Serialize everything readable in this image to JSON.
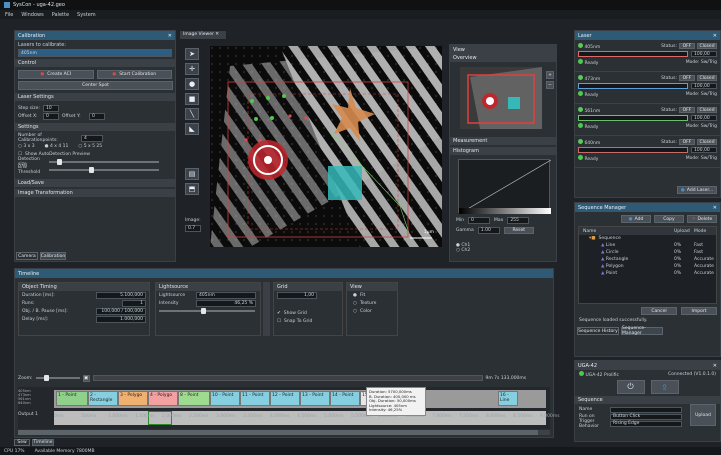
{
  "titlebar": {
    "title": "SysCon - uga-42.geo"
  },
  "menu": [
    "File",
    "Windows",
    "Palette",
    "System"
  ],
  "calibration": {
    "header": "Calibration",
    "lasers_label": "Lasers to calibrate:",
    "laser_value": "405nm",
    "control_label": "Control",
    "create_btn": "Create ACI",
    "start_btn": "Start Calibration",
    "center_btn": "Center Spot",
    "laser_settings": "Laser Settings",
    "step_size_label": "Step size:",
    "step_size": "10",
    "offset_x_label": "Offset X:",
    "offset_x": "0",
    "offset_y_label": "Offset Y:",
    "offset_y": "0",
    "settings": "Settings",
    "num_points_label": "Number of Calibrationpoints:",
    "num_points": "4",
    "radio_3x3": "3 x 3",
    "radio_4x4": "4 x 4 11",
    "radio_5x5": "5 x 5 25",
    "show_auto": "Show AutoDetection Preview",
    "detection_size": "Detection size",
    "bw_threshold": "B/W Threshold",
    "load_save": "Load/Save",
    "image_transformation": "Image Transformation",
    "tabs": [
      "Camera",
      "Calibration"
    ]
  },
  "viewer": {
    "tab": "Image Viewer",
    "scale_label": "1µm",
    "tools": [
      "select-icon",
      "move-icon",
      "circle-icon",
      "rect-icon",
      "line-icon",
      "polygon-icon"
    ],
    "zoom_label": "Image:",
    "zoom_value": "0.7"
  },
  "view_panel": {
    "header": "View",
    "overview": "Overview",
    "measurement": "Measurement",
    "histogram": "Histogram",
    "min_label": "Min",
    "min": "0",
    "max_label": "Max",
    "max": "255",
    "gamma_label": "Gamma",
    "gamma": "1.00",
    "reset_btn": "Reset",
    "channel1": "Ch1",
    "channel2": "Ch2"
  },
  "laser_panel": {
    "header": "Laser",
    "lasers": [
      {
        "name": "405nm",
        "status": "OFF",
        "mode": "Closed",
        "value": "100,00",
        "ready": "Ready",
        "modelabel": "Mode: Sw/Trig",
        "color": "#d96a6a"
      },
      {
        "name": "473nm",
        "status": "OFF",
        "mode": "Closed",
        "value": "100,00",
        "ready": "Ready",
        "modelabel": "Mode: Sw/Trig",
        "color": "#5da0d8"
      },
      {
        "name": "561nm",
        "status": "OFF",
        "mode": "Closed",
        "value": "100,00",
        "ready": "Ready",
        "modelabel": "Mode: Sw/Trig",
        "color": "#6bbf6b"
      },
      {
        "name": "640nm",
        "status": "OFF",
        "mode": "Closed",
        "value": "100,00",
        "ready": "Ready",
        "modelabel": "Mode: Sw/Trig",
        "color": "#c96a6a"
      }
    ],
    "add_btn": "Add Laser..."
  },
  "sequence": {
    "header": "Sequence Manager",
    "add_btn": "Add",
    "copy_btn": "Copy",
    "delete_btn": "Delete",
    "columns": [
      "Name",
      "Upload",
      "Mode"
    ],
    "root": "Sequence",
    "items": [
      {
        "name": "Line",
        "upload": "0%",
        "mode": "Fast"
      },
      {
        "name": "Circle",
        "upload": "0%",
        "mode": "Fast"
      },
      {
        "name": "Rectangle",
        "upload": "0%",
        "mode": "Accurate"
      },
      {
        "name": "Polygon",
        "upload": "0%",
        "mode": "Accurate"
      },
      {
        "name": "Point",
        "upload": "0%",
        "mode": "Accurate"
      }
    ],
    "cancel_btn": "Cancel",
    "import_btn": "Import",
    "status": "Sequence loaded successfully.",
    "tabs": [
      "Sequence History",
      "Sequence-Manager"
    ]
  },
  "uga": {
    "header": "UGA-42",
    "device": "UGA-42 Prolific",
    "connected": "Connected (V1.0.1.0)",
    "sequence": "Sequence",
    "name_label": "Name",
    "runs_label": "Run on",
    "runs_value": "Button Click",
    "trigger_label": "Trigger Behavior",
    "trigger_value": "Rising Edge",
    "upload_btn": "Upload"
  },
  "timeline": {
    "header": "Timeline",
    "object_timing": "Object Timing",
    "duration_label": "Duration [ms]:",
    "duration": "5.100,000",
    "runs_label": "Runs:",
    "runs": "1",
    "obj_pause_label": "Obj. / B. Pause [ms]:",
    "obj_pause": "100,000 / 100,000",
    "delay_label": "Delay [ms]:",
    "delay": "1.000,000",
    "lightsource": "Lightsource",
    "ls_label": "Lightsource",
    "ls_value": "405nm",
    "intensity_label": "Intensity",
    "intensity": "46,25 %",
    "grid": "Grid",
    "grid_value": "1,00",
    "show_grid": "Show Grid",
    "snap_grid": "Snap To Grid",
    "view": "View",
    "fit": "Fit",
    "texture": "Texture",
    "color": "Color",
    "zoom_label": "Zoom:",
    "total_time": "9m 7s 133,000ms",
    "clips": [
      {
        "label": "1 - Point",
        "color": "#8fd08a"
      },
      {
        "label": "2 - Rectangle",
        "color": "#86cfe0"
      },
      {
        "label": "3 - Polygo",
        "color": "#f0b070"
      },
      {
        "label": "4 - Polygo",
        "color": "#f3a0a0"
      },
      {
        "label": "8 - Point",
        "color": "#9fdb8f"
      },
      {
        "label": "10 - Point",
        "color": "#86cfe0"
      },
      {
        "label": "11 - Point",
        "color": "#86cfe0"
      },
      {
        "label": "12 - Point",
        "color": "#86cfe0"
      },
      {
        "label": "13 - Point",
        "color": "#86cfe0"
      },
      {
        "label": "14 - Point",
        "color": "#86cfe0"
      },
      {
        "label": "15 - Point",
        "color": "#e7e7e7"
      },
      {
        "label": "16 - Line",
        "color": "#86cfe0"
      }
    ],
    "channels": [
      "405nm",
      "473nm",
      "561nm",
      "640nm"
    ],
    "output_label": "Output 1",
    "ticks": [
      "0ms",
      "500ms",
      "1.000ms",
      "1.500ms",
      "2.000ms",
      "2.500ms",
      "3.000ms",
      "3.500ms",
      "4.000ms",
      "4.500ms",
      "5.000ms",
      "5.500ms",
      "6.000ms",
      "6.500ms",
      "7.000ms",
      "7.500ms",
      "8.000ms",
      "8.500ms",
      "9.000ms"
    ],
    "tooltip": [
      "Duration: 5700,000ms",
      "B. Duration: 400,000 ms",
      "Obj. Duration: 50,000ms",
      "Lightsource: 405nm",
      "Intensity: 46,25%"
    ],
    "bottom_tabs": [
      "Sew",
      "Timeline"
    ]
  },
  "statusbar": {
    "cpu": "CPU 17%",
    "memory": "Available Memory 7800MB"
  }
}
